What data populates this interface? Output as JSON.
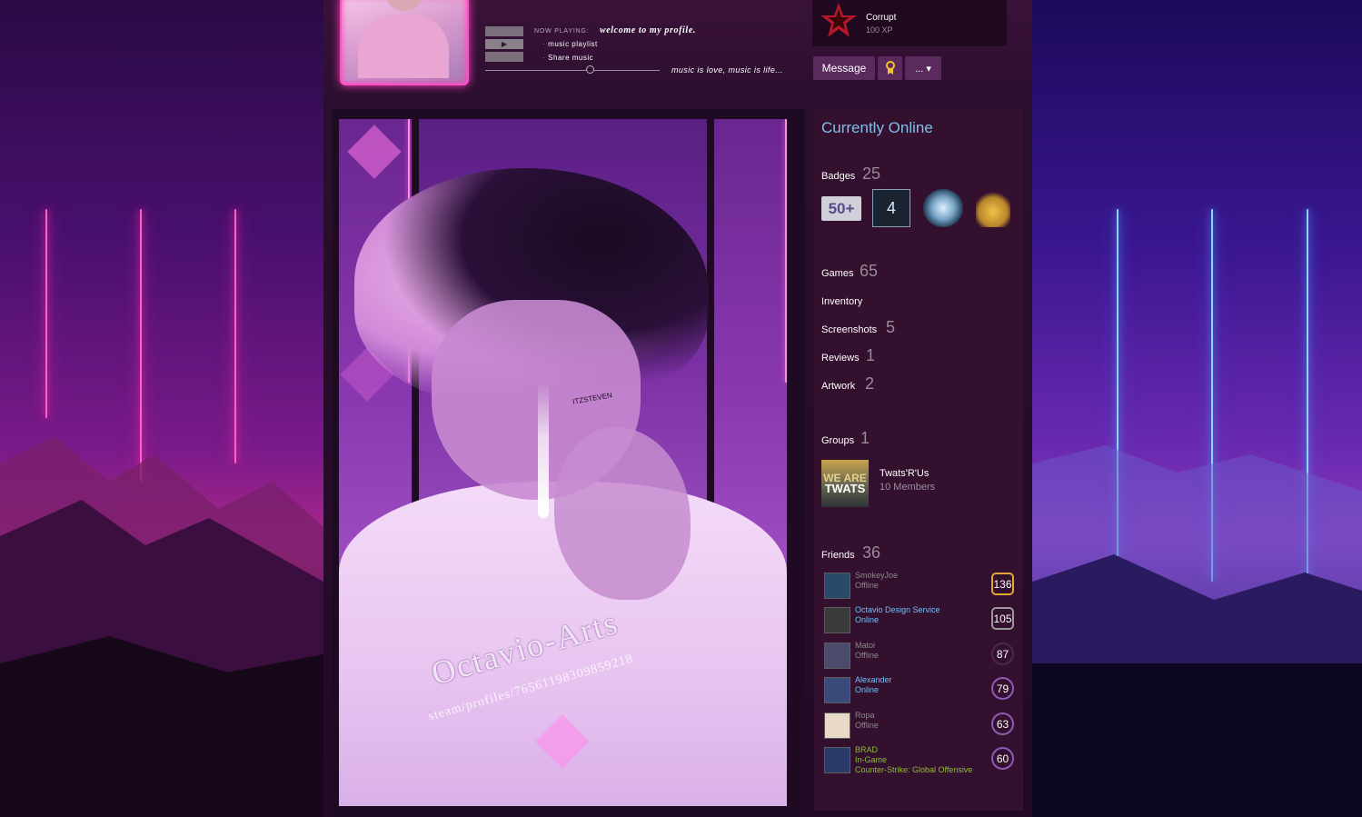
{
  "header": {
    "now_playing_label": "NOW PLAYING:",
    "now_playing_title": "welcome to my profile.",
    "playlist_items": [
      "music playlist",
      "Share music"
    ],
    "tagline": "music is love, music is life..."
  },
  "xp": {
    "name": "Corrupt",
    "value": "100 XP"
  },
  "actions": {
    "message": "Message",
    "more": "... ▾"
  },
  "artwork": {
    "watermark_line1": "Octavio-Arts",
    "watermark_line2": "steam/profiles/76561198309859218",
    "face_tag": "ITZSTEVEN"
  },
  "sidebar": {
    "status": "Currently Online",
    "badges": {
      "label": "Badges",
      "count": "25",
      "items": [
        "50+",
        "4"
      ]
    },
    "games": {
      "label": "Games",
      "count": "65"
    },
    "inventory": {
      "label": "Inventory"
    },
    "screenshots": {
      "label": "Screenshots",
      "count": "5"
    },
    "reviews": {
      "label": "Reviews",
      "count": "1"
    },
    "artwork": {
      "label": "Artwork",
      "count": "2"
    },
    "groups": {
      "label": "Groups",
      "count": "1",
      "group_name": "Twats'R'Us",
      "group_members": "10 Members",
      "group_logo_line1": "WE ARE",
      "group_logo_line2": "TWATS"
    },
    "friends": {
      "label": "Friends",
      "count": "36",
      "list": [
        {
          "name": "SmokeyJoe",
          "status": "Offline",
          "level": "136",
          "state": "offline",
          "color": "#8a8a8a"
        },
        {
          "name": "Octavio Design Service",
          "status": "Online",
          "level": "105",
          "state": "online",
          "color": "#6bc2ff"
        },
        {
          "name": "Matoi",
          "status": "Offline",
          "level": "87",
          "state": "offline",
          "color": "#8a8a8a"
        },
        {
          "name": "Alexander",
          "status": "Online",
          "level": "79",
          "state": "online",
          "color": "#6bc2ff"
        },
        {
          "name": "Ropa",
          "status": "Offline",
          "level": "63",
          "state": "offline",
          "color": "#8a8a8a"
        },
        {
          "name": "BRAD",
          "status": "In-Game",
          "game": "Counter-Strike: Global Offensive",
          "level": "60",
          "state": "ingame",
          "color": "#90ba3c"
        }
      ]
    }
  }
}
